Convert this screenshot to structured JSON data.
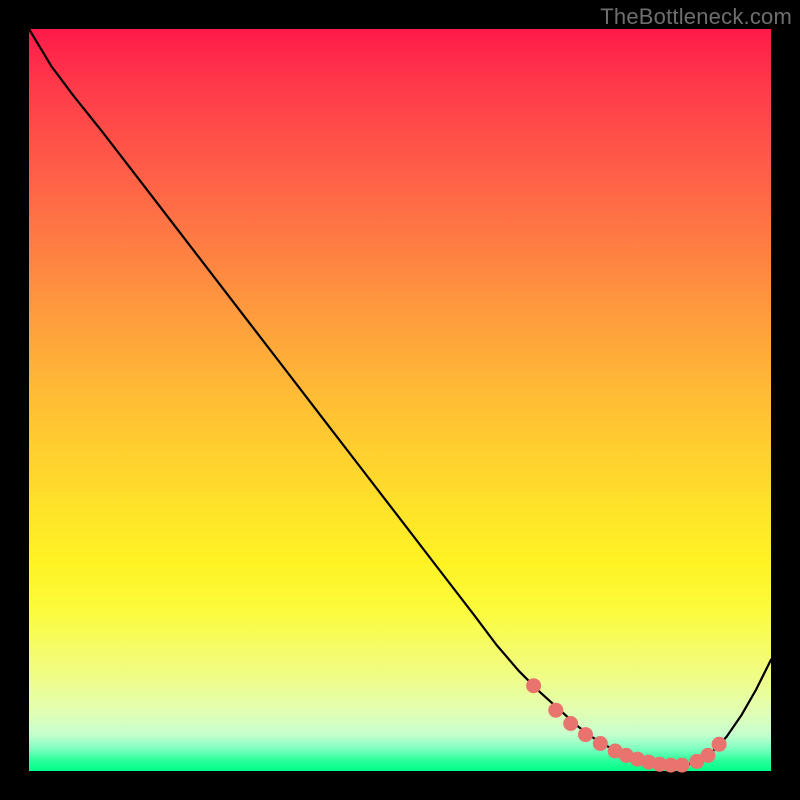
{
  "watermark": "TheBottleneck.com",
  "colors": {
    "dot": "#e9736d",
    "line": "#000000"
  },
  "chart_data": {
    "type": "line",
    "title": "",
    "xlabel": "",
    "ylabel": "",
    "xlim": [
      0,
      100
    ],
    "ylim": [
      0,
      100
    ],
    "grid": false,
    "series": [
      {
        "name": "bottleneck-curve",
        "x": [
          0,
          3,
          6,
          10,
          15,
          20,
          25,
          30,
          35,
          40,
          45,
          50,
          55,
          60,
          63,
          66,
          69,
          72,
          74,
          76,
          78,
          80,
          82,
          84,
          86,
          88,
          90,
          92,
          94,
          96,
          98,
          100
        ],
        "y": [
          100,
          95,
          91,
          86,
          79.5,
          73,
          66.5,
          60,
          53.5,
          47,
          40.5,
          34,
          27.5,
          21,
          17,
          13.5,
          10.5,
          7.8,
          6,
          4.5,
          3.3,
          2.3,
          1.5,
          1,
          0.7,
          0.7,
          1.2,
          2.5,
          4.6,
          7.5,
          11,
          15
        ]
      }
    ],
    "highlight_points": {
      "name": "sweet-spot-dots",
      "x": [
        68,
        71,
        73,
        75,
        77,
        79,
        80.5,
        82,
        83.5,
        85,
        86.5,
        88,
        90,
        91.5,
        93
      ],
      "y": [
        11.5,
        8.2,
        6.4,
        4.9,
        3.7,
        2.7,
        2.1,
        1.6,
        1.2,
        0.9,
        0.8,
        0.8,
        1.3,
        2.1,
        3.6
      ]
    }
  }
}
